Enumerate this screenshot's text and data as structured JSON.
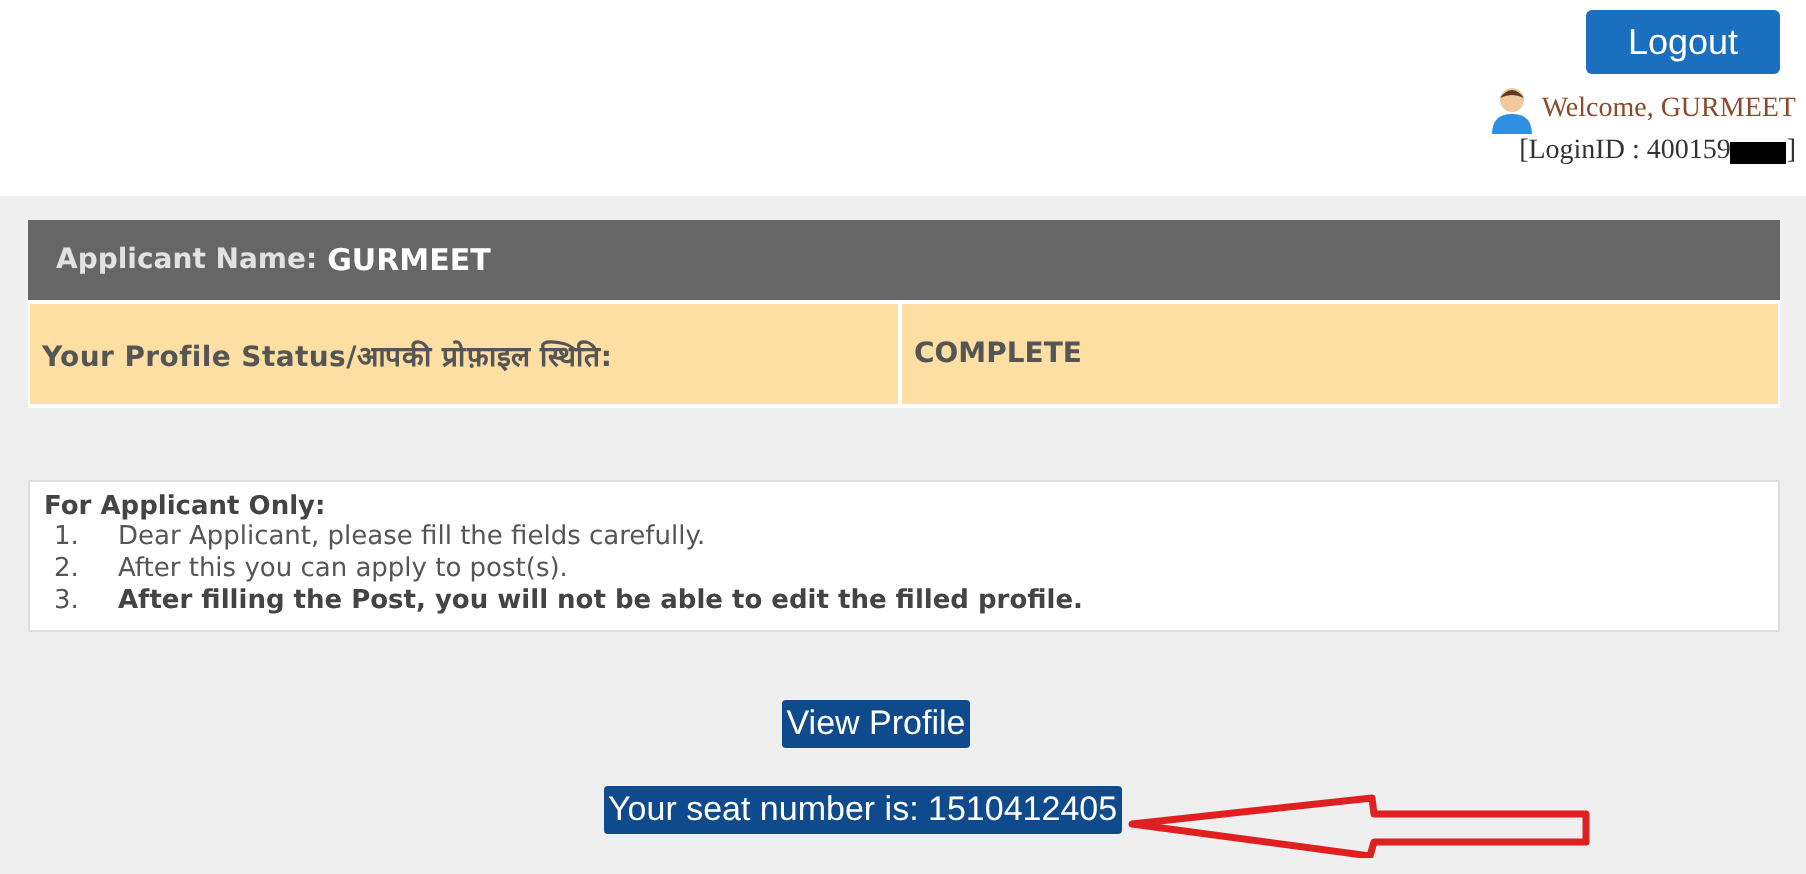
{
  "header": {
    "logout_button": "Logout",
    "welcome": "Welcome, GURMEET",
    "login_id": "[LoginID : 400159",
    "login_id_redacted": true,
    "login_id_end": "]"
  },
  "applicant": {
    "label": "Applicant Name:",
    "name": "GURMEET",
    "status_label": "Your Profile Status/आपकी प्रोफ़ाइल स्थिति:",
    "status_value": "COMPLETE"
  },
  "instructions": {
    "title": "For Applicant Only:",
    "items": [
      {
        "number": "1.",
        "text": "Dear Applicant, please fill the fields carefully.",
        "bold": false
      },
      {
        "number": "2.",
        "text": "After this you can apply to post(s).",
        "bold": false
      },
      {
        "number": "3.",
        "text": "After filling the Post, you will not be able to edit the filled profile.",
        "bold": true
      }
    ]
  },
  "view_profile_button": "View Profile",
  "seat_number": "Your seat number is: 1510412405"
}
